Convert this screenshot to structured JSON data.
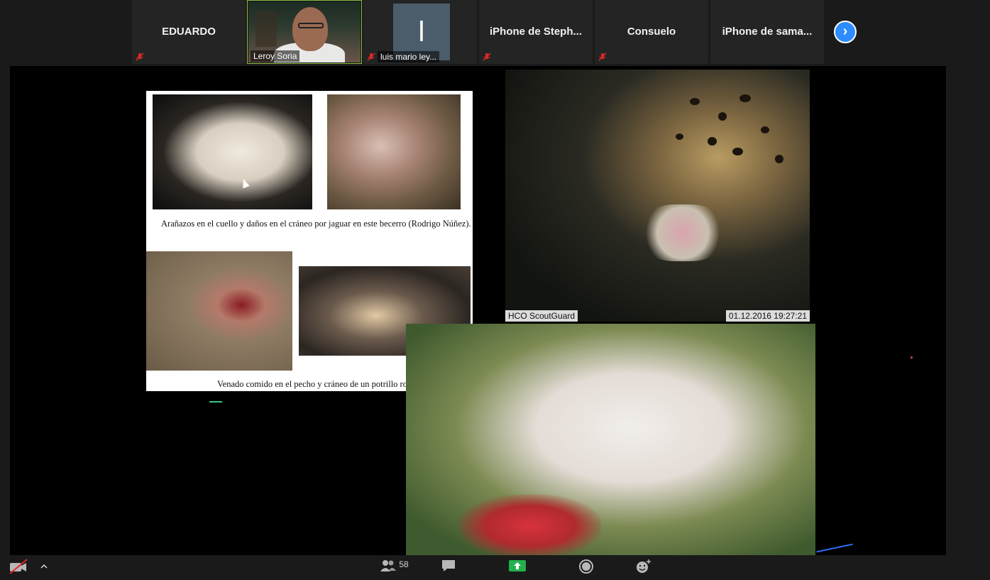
{
  "participants": [
    {
      "name": "EDUARDO",
      "muted": true
    },
    {
      "name": "Leroy Soria",
      "video": true
    },
    {
      "name": "luis mario ley...",
      "initial": "l",
      "muted": true
    },
    {
      "name": "iPhone de Steph...",
      "muted": true
    },
    {
      "name": "Consuelo",
      "muted": true
    },
    {
      "name": "iPhone de sama..."
    }
  ],
  "slide": {
    "caption_top": "Arañazos en el cuello y daños en el cráneo por jaguar en este becerro (Rodrigo Núñez).",
    "caption_bottom": "Venado comido en el pecho y cráneo de un potrillo roto por jaguar",
    "camera_brand": "HCO ScoutGuard",
    "camera_timestamp": "01.12.2016 19:27:21"
  },
  "toolbar": {
    "participants_count": "58"
  },
  "colors": {
    "accent_blue": "#2d8cff",
    "share_green": "#23b14d",
    "mute_red": "#e02828",
    "active_speaker_border": "#8fbf3f"
  }
}
